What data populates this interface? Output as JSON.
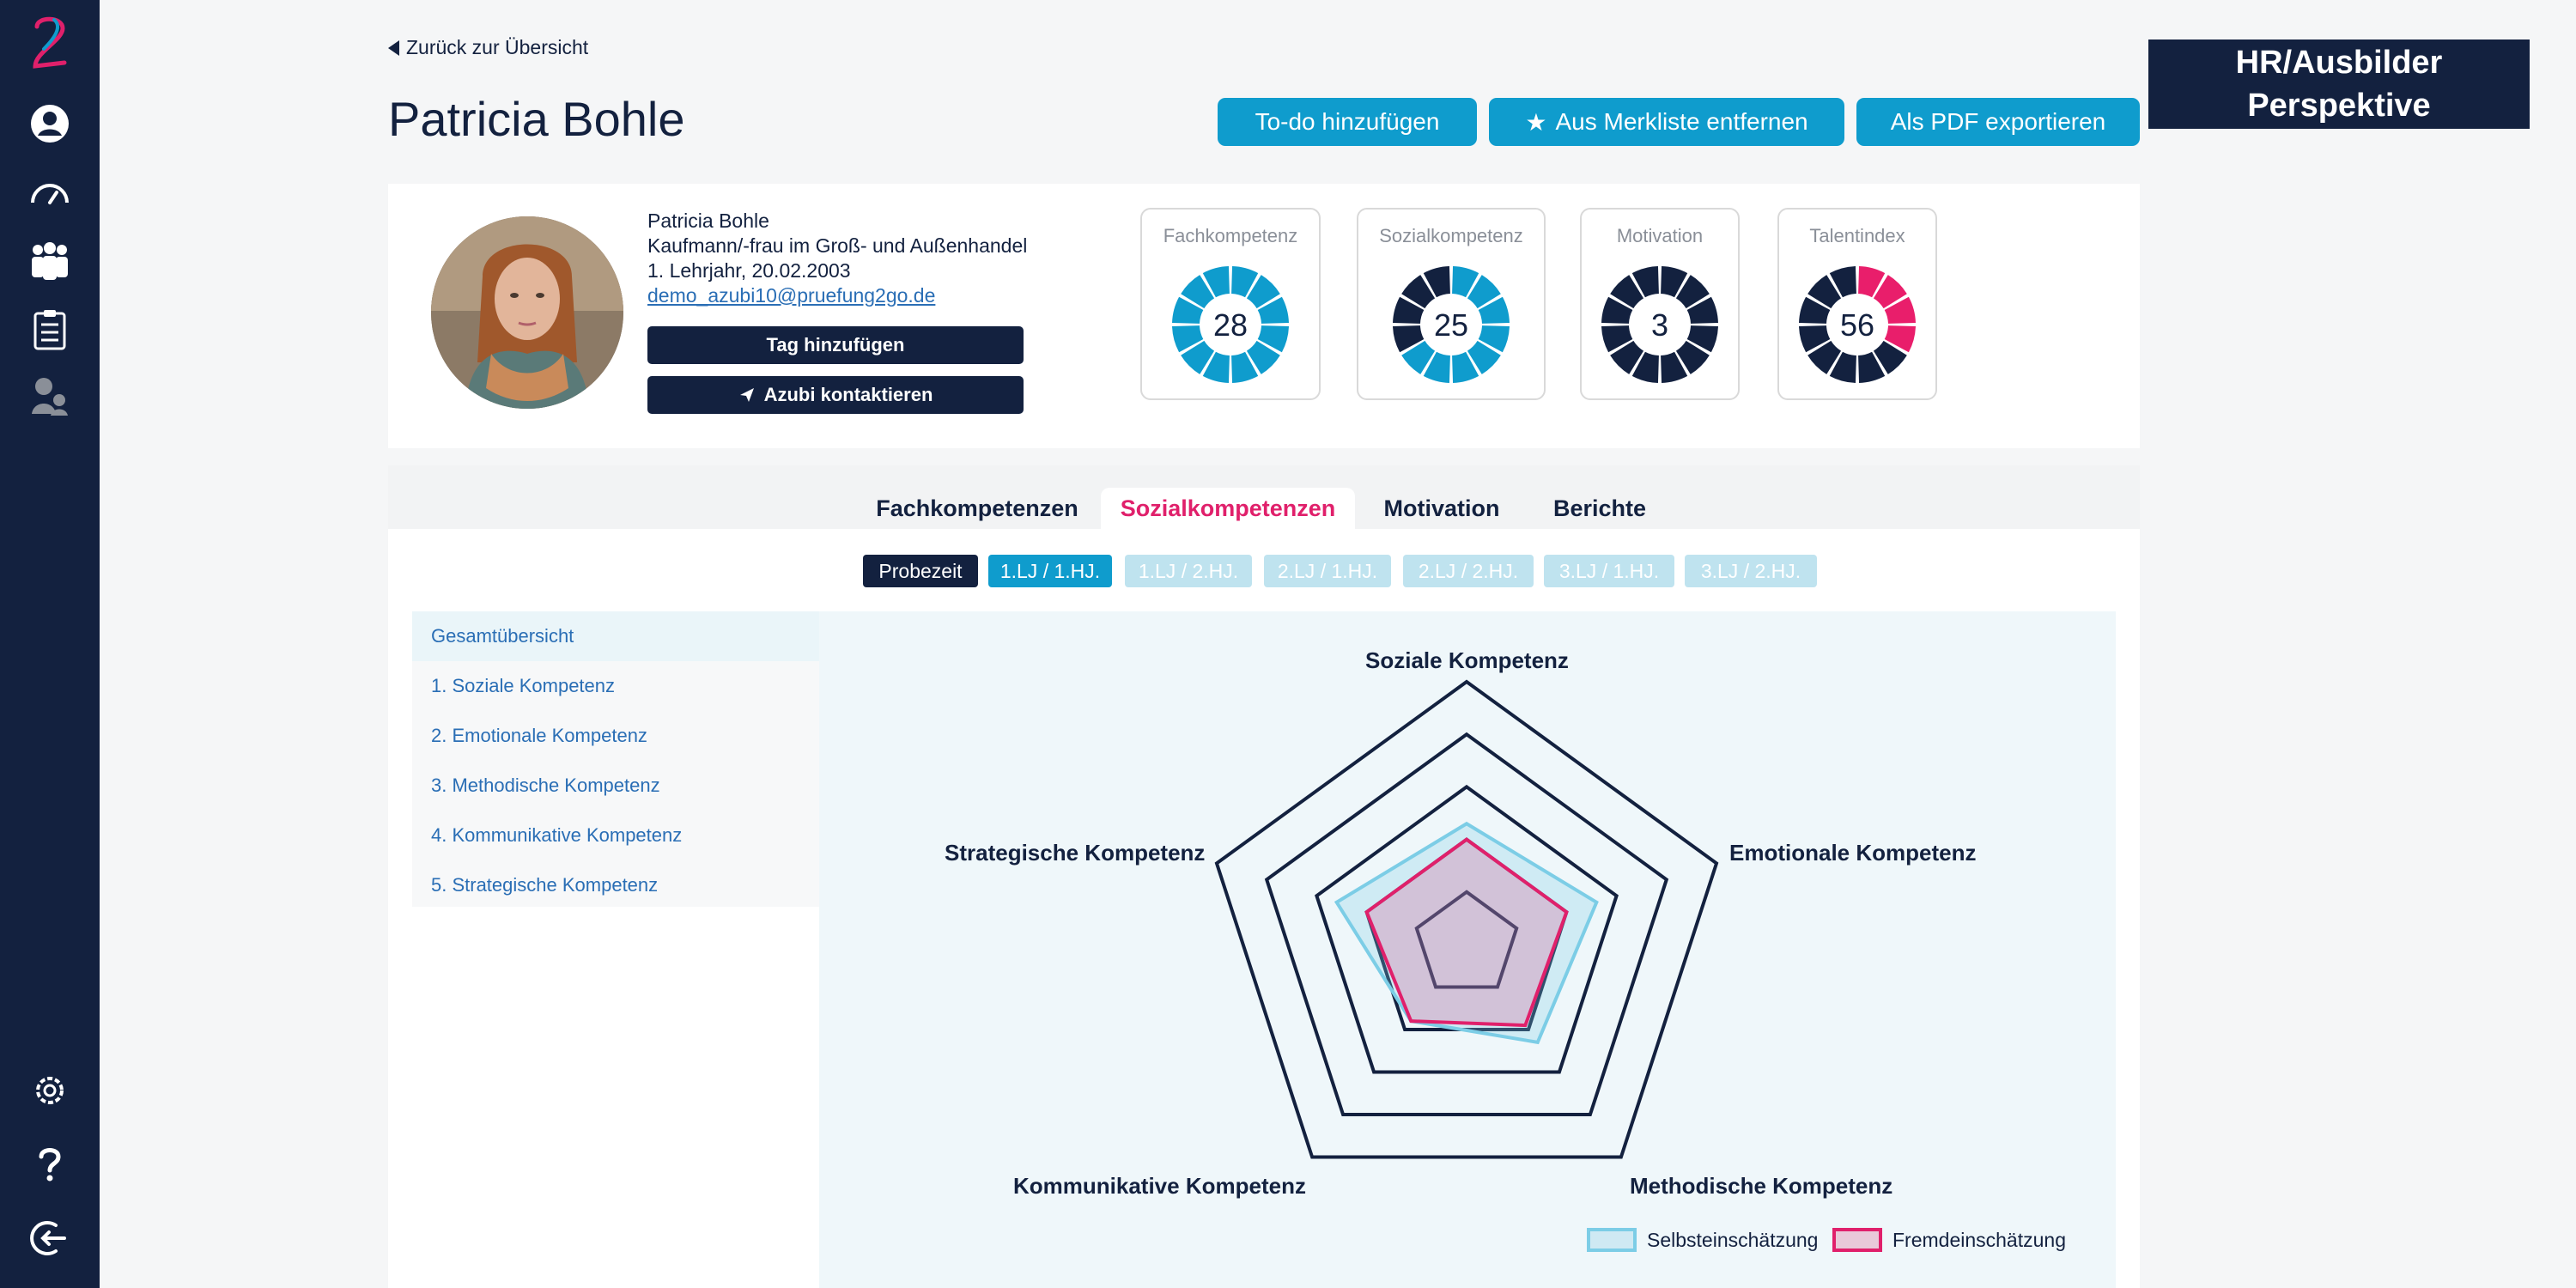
{
  "nav": {
    "back_label": "Zurück zur Übersicht",
    "sidebar_icons": [
      "logo-icon",
      "user-icon",
      "dashboard-icon",
      "group-icon",
      "clipboard-icon",
      "mentor-icon",
      "settings-icon",
      "help-icon",
      "logout-icon"
    ]
  },
  "header": {
    "title": "Patricia Bohle",
    "todo_button": "To-do hinzufügen",
    "watchlist_button": "Aus Merkliste entfernen",
    "pdf_button": "Als PDF exportieren",
    "perspective_line1": "HR/Ausbilder",
    "perspective_line2": "Perspektive"
  },
  "profile": {
    "name": "Patricia Bohle",
    "occupation": "Kaufmann/-frau im Groß- und Außenhandel",
    "year_birth": "1. Lehrjahr, 20.02.2003",
    "email": "demo_azubi10@pruefung2go.de",
    "tag_button": "Tag hinzufügen",
    "contact_button": "Azubi kontaktieren"
  },
  "kpis": [
    {
      "label": "Fachkompetenz",
      "value": "28",
      "filled_segments": 12,
      "fill_color": "#0f9ccd"
    },
    {
      "label": "Sozialkompetenz",
      "value": "25",
      "filled_segments": 8,
      "fill_color": "#0f9ccd"
    },
    {
      "label": "Motivation",
      "value": "3",
      "filled_segments": 0,
      "fill_color": "#0f9ccd"
    },
    {
      "label": "Talentindex",
      "value": "56",
      "filled_segments": 4,
      "fill_color": "#e91e6b"
    }
  ],
  "tabs": [
    {
      "label": "Fachkompetenzen",
      "active": false
    },
    {
      "label": "Sozialkompetenzen",
      "active": true
    },
    {
      "label": "Motivation",
      "active": false
    },
    {
      "label": "Berichte",
      "active": false
    }
  ],
  "periods": [
    "Probezeit",
    "1.LJ / 1.HJ.",
    "1.LJ / 2.HJ.",
    "2.LJ / 1.HJ.",
    "2.LJ / 2.HJ.",
    "3.LJ / 1.HJ.",
    "3.LJ / 2.HJ."
  ],
  "subnav": [
    "Gesamtübersicht",
    "1. Soziale Kompetenz",
    "2. Emotionale Kompetenz",
    "3. Methodische Kompetenz",
    "4. Kommunikative Kompetenz",
    "5. Strategische Kompetenz"
  ],
  "chart_data": {
    "type": "radar",
    "axes": [
      "Soziale Kompetenz",
      "Emotionale Kompetenz",
      "Methodische Kompetenz",
      "Kommunikative Kompetenz",
      "Strategische Kompetenz"
    ],
    "levels": 5,
    "series": [
      {
        "name": "Selbsteinschätzung",
        "values": [
          2.3,
          2.6,
          2.3,
          1.8,
          2.6
        ],
        "color": "#7ccde6"
      },
      {
        "name": "Fremdeinschätzung",
        "values": [
          2.0,
          2.0,
          1.9,
          1.8,
          2.0
        ],
        "color": "#e0206b"
      }
    ],
    "legend": "bottom-right",
    "colors": {
      "grid": "#13213f",
      "fill": "#eff7fa"
    }
  }
}
